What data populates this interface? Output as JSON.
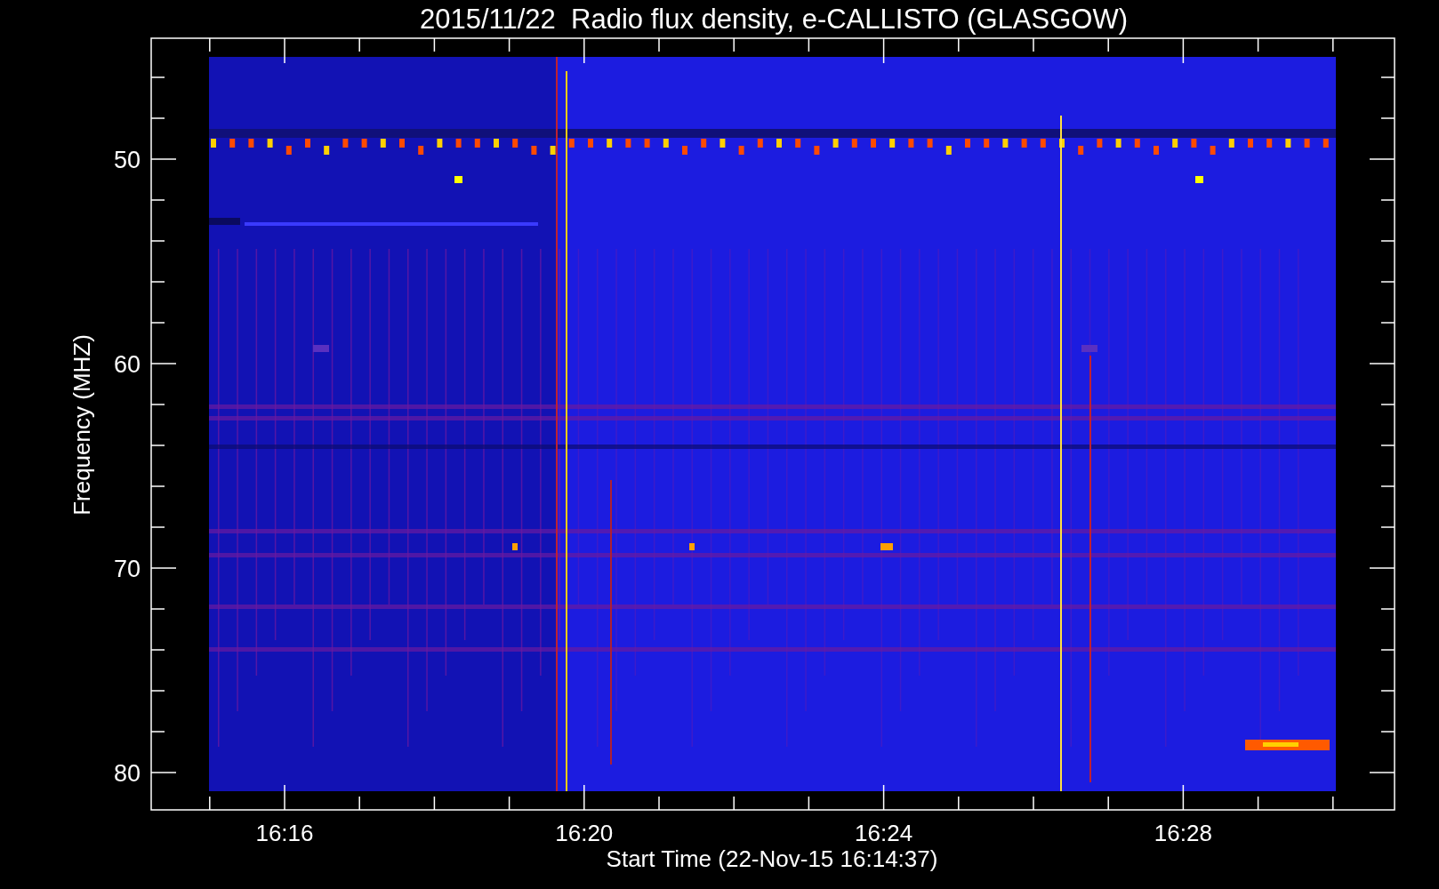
{
  "title": "2015/11/22  Radio flux density, e-CALLISTO (GLASGOW)",
  "y_axis": {
    "label": "Frequency (MHZ)",
    "ticks": [
      "50",
      "60",
      "70",
      "80"
    ]
  },
  "x_axis": {
    "label": "Start Time (22-Nov-15 16:14:37)",
    "ticks": [
      "16:16",
      "16:20",
      "16:24",
      "16:28"
    ]
  }
}
